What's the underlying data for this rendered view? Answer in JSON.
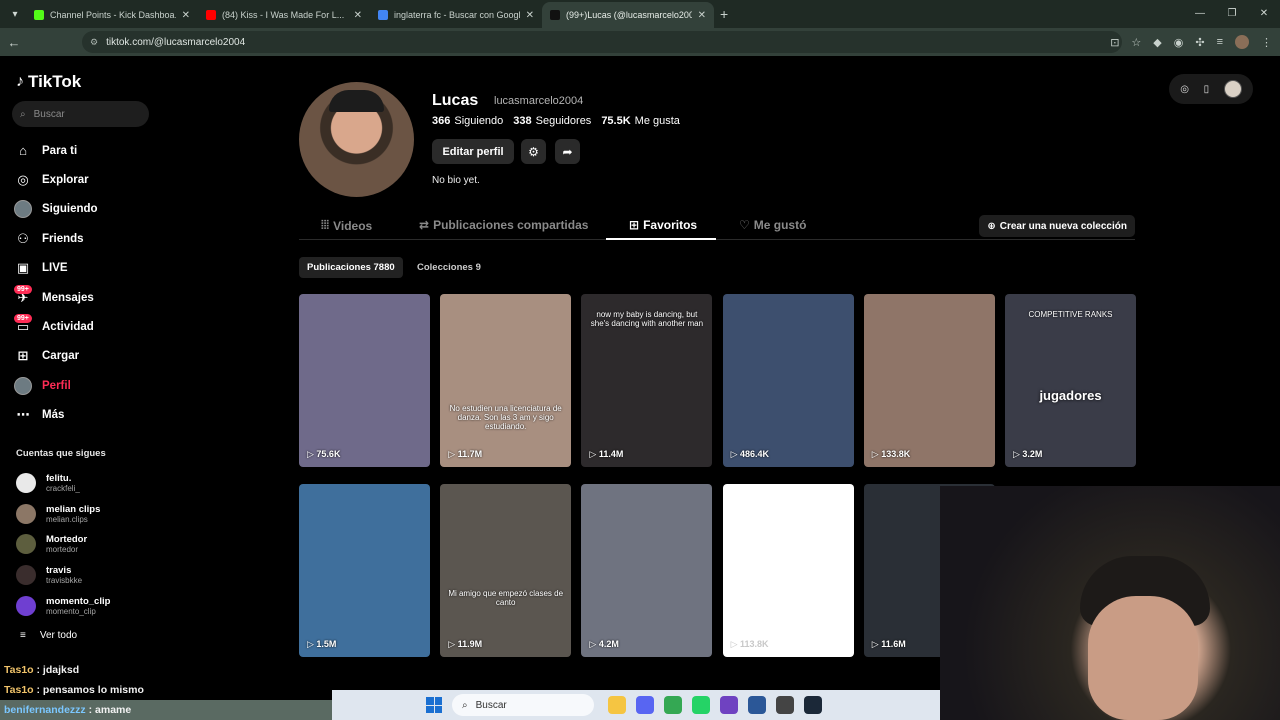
{
  "browser": {
    "tabs": [
      {
        "label": "Channel Points - Kick Dashboa...",
        "color": "#53fc18",
        "active": false
      },
      {
        "label": "(84) Kiss - I Was Made For L...",
        "color": "#ff0000",
        "active": false
      },
      {
        "label": "inglaterra fc - Buscar con Googl...",
        "color": "#4285f4",
        "active": false
      },
      {
        "label": "(99+)Lucas (@lucasmarcelo200...",
        "color": "#111111",
        "active": true
      }
    ],
    "url": "tiktok.com/@lucasmarcelo2004"
  },
  "sidebar": {
    "logo": "TikTok",
    "search_placeholder": "Buscar",
    "nav": [
      {
        "label": "Para ti",
        "icon": "home-icon"
      },
      {
        "label": "Explorar",
        "icon": "compass-icon"
      },
      {
        "label": "Siguiendo",
        "icon": "following-avatar-icon"
      },
      {
        "label": "Friends",
        "icon": "friends-icon"
      },
      {
        "label": "LIVE",
        "icon": "live-icon"
      },
      {
        "label": "Mensajes",
        "icon": "messages-icon",
        "badge": "99+"
      },
      {
        "label": "Actividad",
        "icon": "activity-icon",
        "badge": "99+"
      },
      {
        "label": "Cargar",
        "icon": "upload-icon"
      },
      {
        "label": "Perfil",
        "icon": "profile-avatar-icon"
      },
      {
        "label": "Más",
        "icon": "more-icon"
      }
    ],
    "following_title": "Cuentas que sigues",
    "following": [
      {
        "name": "felitu.",
        "handle": "crackfeli_",
        "color": "#e9e9e9"
      },
      {
        "name": "melian clips",
        "handle": "melian.clips",
        "color": "#8c7766"
      },
      {
        "name": "Mortedor",
        "handle": "mortedor",
        "color": "#5d5e3e"
      },
      {
        "name": "travis",
        "handle": "travisbkke",
        "color": "#3a2d2d"
      },
      {
        "name": "momento_clip",
        "handle": "momento_clip",
        "color": "#6f3fd1"
      }
    ],
    "see_all": "Ver todo"
  },
  "profile": {
    "name": "Lucas",
    "handle": "lucasmarcelo2004",
    "following_count": "366",
    "following_label": "Siguiendo",
    "followers_count": "338",
    "followers_label": "Seguidores",
    "likes_count": "75.5K",
    "likes_label": "Me gusta",
    "edit_label": "Editar perfil",
    "bio": "No bio yet."
  },
  "tabs": {
    "videos": "Videos",
    "shared": "Publicaciones compartidas",
    "favorites": "Favoritos",
    "liked": "Me gustó",
    "new_collection": "Crear una nueva colección"
  },
  "chips": {
    "posts": "Publicaciones 7880",
    "collections": "Colecciones 9"
  },
  "videos": [
    {
      "views": "75.6K",
      "bg": "#6f6a8a",
      "caption": "",
      "big": ""
    },
    {
      "views": "11.7M",
      "bg": "#a88f80",
      "caption": "No estudien una licenciatura de danza. Son las 3 am y sigo estudiando.",
      "big": ""
    },
    {
      "views": "11.4M",
      "bg": "#2d2a2c",
      "caption": "now my baby is dancing, but she's dancing with another man",
      "big": ""
    },
    {
      "views": "486.4K",
      "bg": "#3d4f6e",
      "caption": "",
      "big": ""
    },
    {
      "views": "133.8K",
      "bg": "#8f7568",
      "caption": "",
      "big": ""
    },
    {
      "views": "3.2M",
      "bg": "#3a3c48",
      "caption": "COMPETITIVE RANKS",
      "big": "jugadores"
    },
    {
      "views": "1.5M",
      "bg": "#3f6f9c",
      "caption": "",
      "big": ""
    },
    {
      "views": "11.9M",
      "bg": "#5b5650",
      "caption": "Mi amigo que empezó clases de canto",
      "big": ""
    },
    {
      "views": "4.2M",
      "bg": "#6f7380",
      "caption": "",
      "big": ""
    },
    {
      "views": "113.8K",
      "bg": "#ffffff",
      "caption": "",
      "big": ""
    },
    {
      "views": "11.6M",
      "bg": "#2a2f36",
      "caption": "",
      "big": ""
    }
  ],
  "chat": [
    {
      "user": "Tas1o",
      "msg": "jdajksd"
    },
    {
      "user": "Tas1o",
      "msg": "pensamos lo mismo"
    },
    {
      "user": "benifernandezzz",
      "msg": "amame"
    }
  ],
  "taskbar": {
    "search_placeholder": "Buscar"
  }
}
